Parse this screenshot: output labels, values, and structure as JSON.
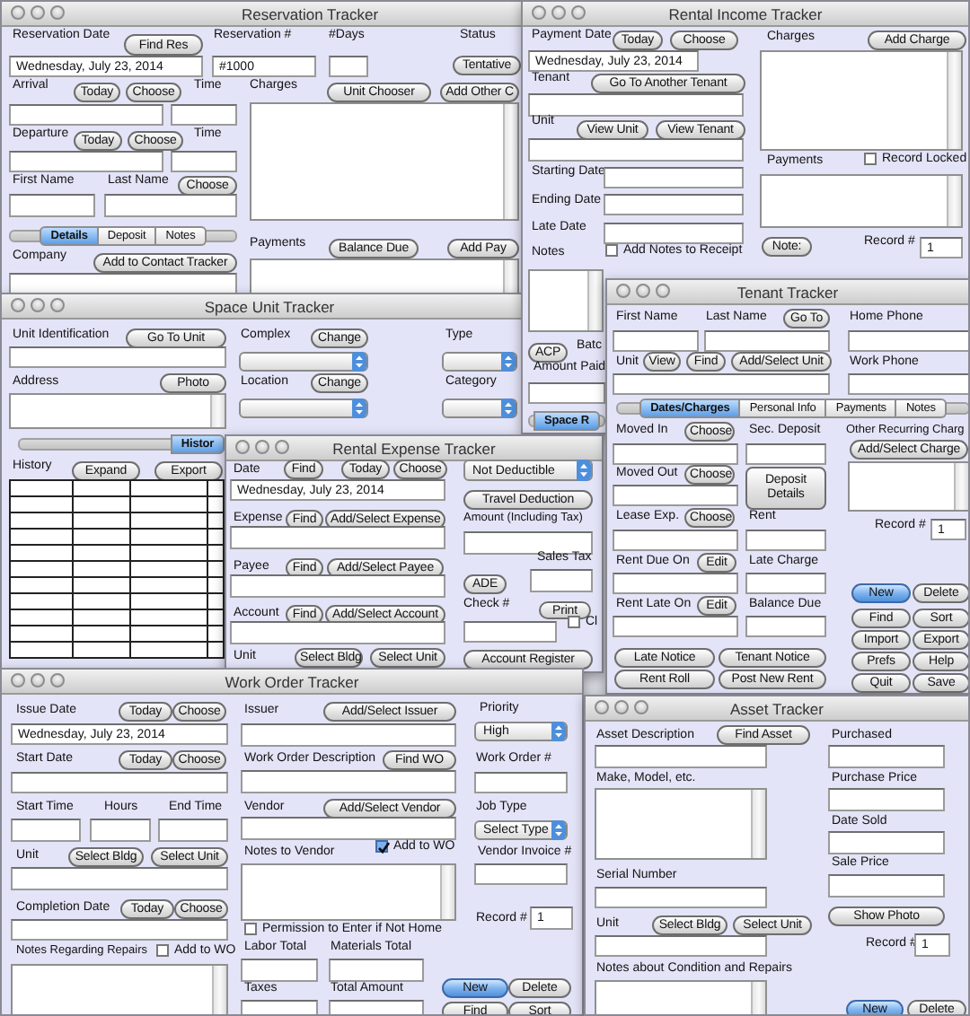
{
  "windows": [
    {
      "title": "Reservation Tracker",
      "widgets": [
        {
          "kind": "label",
          "text": "Reservation Date"
        },
        {
          "kind": "button",
          "text": "Find Res"
        },
        {
          "kind": "label",
          "text": "Reservation #"
        },
        {
          "kind": "label",
          "text": "#Days"
        },
        {
          "kind": "label",
          "text": "Status"
        },
        {
          "kind": "field",
          "value": "Wednesday, July 23, 2014"
        },
        {
          "kind": "field",
          "value": "#1000"
        },
        {
          "kind": "field"
        },
        {
          "kind": "button",
          "text": "Tentative"
        },
        {
          "kind": "label",
          "text": "Arrival"
        },
        {
          "kind": "button",
          "text": "Today"
        },
        {
          "kind": "button",
          "text": "Choose"
        },
        {
          "kind": "label",
          "text": "Time"
        },
        {
          "kind": "field"
        },
        {
          "kind": "field"
        },
        {
          "kind": "label",
          "text": "Departure"
        },
        {
          "kind": "button",
          "text": "Today"
        },
        {
          "kind": "button",
          "text": "Choose"
        },
        {
          "kind": "label",
          "text": "Time"
        },
        {
          "kind": "field"
        },
        {
          "kind": "field"
        },
        {
          "kind": "label",
          "text": "First Name"
        },
        {
          "kind": "label",
          "text": "Last Name"
        },
        {
          "kind": "button",
          "text": "Choose"
        },
        {
          "kind": "field"
        },
        {
          "kind": "field"
        },
        {
          "kind": "tabs",
          "tabs": [
            {
              "label": "Details",
              "selected": true
            },
            {
              "label": "Deposit",
              "selected": false
            },
            {
              "label": "Notes",
              "selected": false
            }
          ]
        },
        {
          "kind": "label",
          "text": "Company"
        },
        {
          "kind": "button",
          "text": "Add to Contact Tracker"
        },
        {
          "kind": "field"
        },
        {
          "kind": "label",
          "text": "Charges"
        },
        {
          "kind": "button",
          "text": "Unit Chooser"
        },
        {
          "kind": "button",
          "text": "Add Other C"
        },
        {
          "kind": "text-area"
        },
        {
          "kind": "label",
          "text": "Payments"
        },
        {
          "kind": "button",
          "text": "Balance Due"
        },
        {
          "kind": "button",
          "text": "Add Pay"
        },
        {
          "kind": "text-area"
        }
      ]
    },
    {
      "title": "Space Unit Tracker",
      "widgets": [
        {
          "kind": "label",
          "text": "Unit Identification"
        },
        {
          "kind": "button",
          "text": "Go To Unit"
        },
        {
          "kind": "field"
        },
        {
          "kind": "label",
          "text": "Address"
        },
        {
          "kind": "button",
          "text": "Photo"
        },
        {
          "kind": "text-area"
        },
        {
          "kind": "label",
          "text": "Complex"
        },
        {
          "kind": "button",
          "text": "Change"
        },
        {
          "kind": "select"
        },
        {
          "kind": "label",
          "text": "Location"
        },
        {
          "kind": "button",
          "text": "Change"
        },
        {
          "kind": "select"
        },
        {
          "kind": "label",
          "text": "Type"
        },
        {
          "kind": "select"
        },
        {
          "kind": "label",
          "text": "Category"
        },
        {
          "kind": "select"
        },
        {
          "kind": "tabs",
          "tabs": [
            {
              "label": "Histor",
              "selected": true
            }
          ]
        },
        {
          "kind": "label",
          "text": "History"
        },
        {
          "kind": "button",
          "text": "Expand"
        },
        {
          "kind": "button",
          "text": "Export"
        },
        {
          "kind": "table"
        }
      ]
    },
    {
      "title": "Rental Income Tracker",
      "widgets": [
        {
          "kind": "label",
          "text": "Payment Date"
        },
        {
          "kind": "button",
          "text": "Today"
        },
        {
          "kind": "button",
          "text": "Choose"
        },
        {
          "kind": "field",
          "value": "Wednesday, July 23, 2014"
        },
        {
          "kind": "label",
          "text": "Tenant"
        },
        {
          "kind": "button",
          "text": "Go To Another Tenant"
        },
        {
          "kind": "field"
        },
        {
          "kind": "label",
          "text": "Unit"
        },
        {
          "kind": "button",
          "text": "View Unit"
        },
        {
          "kind": "button",
          "text": "View Tenant"
        },
        {
          "kind": "field"
        },
        {
          "kind": "label",
          "text": "Starting Date"
        },
        {
          "kind": "field"
        },
        {
          "kind": "label",
          "text": "Ending Date"
        },
        {
          "kind": "field"
        },
        {
          "kind": "label",
          "text": "Late Date"
        },
        {
          "kind": "field"
        },
        {
          "kind": "label",
          "text": "Notes"
        },
        {
          "kind": "checkbox",
          "text": "Add Notes to Receipt",
          "checked": false
        },
        {
          "kind": "text-area"
        },
        {
          "kind": "button",
          "text": "ACP"
        },
        {
          "kind": "label",
          "text": "Batc"
        },
        {
          "kind": "label",
          "text": "Amount Paid"
        },
        {
          "kind": "field"
        },
        {
          "kind": "tabs",
          "tabs": [
            {
              "label": "Space R",
              "selected": true
            }
          ]
        },
        {
          "kind": "label",
          "text": "Charges"
        },
        {
          "kind": "button",
          "text": "Add Charge"
        },
        {
          "kind": "text-area"
        },
        {
          "kind": "label",
          "text": "Payments"
        },
        {
          "kind": "checkbox",
          "text": "Record Locked",
          "checked": false
        },
        {
          "kind": "text-area"
        },
        {
          "kind": "button",
          "text": "Note:"
        },
        {
          "kind": "label",
          "text": "Record #"
        },
        {
          "kind": "field",
          "value": "1"
        }
      ]
    },
    {
      "title": "Rental Expense Tracker",
      "widgets": [
        {
          "kind": "label",
          "text": "Date"
        },
        {
          "kind": "button",
          "text": "Find"
        },
        {
          "kind": "button",
          "text": "Today"
        },
        {
          "kind": "button",
          "text": "Choose"
        },
        {
          "kind": "field",
          "value": "Wednesday, July 23, 2014"
        },
        {
          "kind": "label",
          "text": "Expense"
        },
        {
          "kind": "button",
          "text": "Find"
        },
        {
          "kind": "button",
          "text": "Add/Select Expense"
        },
        {
          "kind": "field"
        },
        {
          "kind": "label",
          "text": "Payee"
        },
        {
          "kind": "button",
          "text": "Find"
        },
        {
          "kind": "button",
          "text": "Add/Select Payee"
        },
        {
          "kind": "field"
        },
        {
          "kind": "label",
          "text": "Account"
        },
        {
          "kind": "button",
          "text": "Find"
        },
        {
          "kind": "button",
          "text": "Add/Select Account"
        },
        {
          "kind": "field"
        },
        {
          "kind": "label",
          "text": "Unit"
        },
        {
          "kind": "button",
          "text": "Select Bldg"
        },
        {
          "kind": "button",
          "text": "Select Unit"
        },
        {
          "kind": "select",
          "value": "Not Deductible"
        },
        {
          "kind": "button",
          "text": "Travel Deduction"
        },
        {
          "kind": "label",
          "text": "Amount (Including Tax)"
        },
        {
          "kind": "field"
        },
        {
          "kind": "label",
          "text": "Sales Tax"
        },
        {
          "kind": "button",
          "text": "ADE"
        },
        {
          "kind": "field"
        },
        {
          "kind": "label",
          "text": "Check #"
        },
        {
          "kind": "button",
          "text": "Print"
        },
        {
          "kind": "field"
        },
        {
          "kind": "checkbox",
          "text": "Cl",
          "checked": false
        },
        {
          "kind": "button",
          "text": "Account Register"
        }
      ]
    },
    {
      "title": "Tenant Tracker",
      "widgets": [
        {
          "kind": "label",
          "text": "First Name"
        },
        {
          "kind": "label",
          "text": "Last Name"
        },
        {
          "kind": "button",
          "text": "Go To"
        },
        {
          "kind": "label",
          "text": "Home Phone"
        },
        {
          "kind": "field"
        },
        {
          "kind": "field"
        },
        {
          "kind": "field"
        },
        {
          "kind": "label",
          "text": "Unit"
        },
        {
          "kind": "button",
          "text": "View"
        },
        {
          "kind": "button",
          "text": "Find"
        },
        {
          "kind": "button",
          "text": "Add/Select Unit"
        },
        {
          "kind": "label",
          "text": "Work Phone"
        },
        {
          "kind": "field"
        },
        {
          "kind": "field"
        },
        {
          "kind": "tabs",
          "tabs": [
            {
              "label": "Dates/Charges",
              "selected": true
            },
            {
              "label": "Personal Info",
              "selected": false
            },
            {
              "label": "Payments",
              "selected": false
            },
            {
              "label": "Notes",
              "selected": false
            }
          ]
        },
        {
          "kind": "label",
          "text": "Moved In"
        },
        {
          "kind": "button",
          "text": "Choose"
        },
        {
          "kind": "label",
          "text": "Sec. Deposit"
        },
        {
          "kind": "label",
          "text": "Other Recurring Charg"
        },
        {
          "kind": "button",
          "text": "Add/Select Charge"
        },
        {
          "kind": "field"
        },
        {
          "kind": "field"
        },
        {
          "kind": "text-area"
        },
        {
          "kind": "label",
          "text": "Moved Out"
        },
        {
          "kind": "button",
          "text": "Choose"
        },
        {
          "kind": "button",
          "text": "Deposit Details"
        },
        {
          "kind": "field"
        },
        {
          "kind": "label",
          "text": "Lease Exp."
        },
        {
          "kind": "button",
          "text": "Choose"
        },
        {
          "kind": "label",
          "text": "Rent"
        },
        {
          "kind": "label",
          "text": "Record #"
        },
        {
          "kind": "field",
          "value": "1"
        },
        {
          "kind": "field"
        },
        {
          "kind": "field"
        },
        {
          "kind": "label",
          "text": "Rent Due On"
        },
        {
          "kind": "button",
          "text": "Edit"
        },
        {
          "kind": "label",
          "text": "Late Charge"
        },
        {
          "kind": "field"
        },
        {
          "kind": "field"
        },
        {
          "kind": "button",
          "text": "New",
          "primary": true
        },
        {
          "kind": "button",
          "text": "Delete"
        },
        {
          "kind": "label",
          "text": "Rent Late On"
        },
        {
          "kind": "button",
          "text": "Edit"
        },
        {
          "kind": "label",
          "text": "Balance Due"
        },
        {
          "kind": "button",
          "text": "Find"
        },
        {
          "kind": "button",
          "text": "Sort"
        },
        {
          "kind": "field"
        },
        {
          "kind": "field"
        },
        {
          "kind": "button",
          "text": "Import"
        },
        {
          "kind": "button",
          "text": "Export"
        },
        {
          "kind": "button",
          "text": "Late Notice"
        },
        {
          "kind": "button",
          "text": "Tenant Notice"
        },
        {
          "kind": "button",
          "text": "Prefs"
        },
        {
          "kind": "button",
          "text": "Help"
        },
        {
          "kind": "button",
          "text": "Rent Roll"
        },
        {
          "kind": "button",
          "text": "Post New Rent"
        },
        {
          "kind": "button",
          "text": "Quit"
        },
        {
          "kind": "button",
          "text": "Save"
        }
      ]
    },
    {
      "title": "Work Order Tracker",
      "widgets": [
        {
          "kind": "label",
          "text": "Issue Date"
        },
        {
          "kind": "button",
          "text": "Today"
        },
        {
          "kind": "button",
          "text": "Choose"
        },
        {
          "kind": "field",
          "value": "Wednesday, July 23, 2014"
        },
        {
          "kind": "label",
          "text": "Start Date"
        },
        {
          "kind": "button",
          "text": "Today"
        },
        {
          "kind": "button",
          "text": "Choose"
        },
        {
          "kind": "field"
        },
        {
          "kind": "label",
          "text": "Start Time"
        },
        {
          "kind": "label",
          "text": "Hours"
        },
        {
          "kind": "label",
          "text": "End Time"
        },
        {
          "kind": "field"
        },
        {
          "kind": "field"
        },
        {
          "kind": "field"
        },
        {
          "kind": "label",
          "text": "Unit"
        },
        {
          "kind": "button",
          "text": "Select Bldg"
        },
        {
          "kind": "button",
          "text": "Select Unit"
        },
        {
          "kind": "field"
        },
        {
          "kind": "label",
          "text": "Completion Date"
        },
        {
          "kind": "button",
          "text": "Today"
        },
        {
          "kind": "button",
          "text": "Choose"
        },
        {
          "kind": "field"
        },
        {
          "kind": "label",
          "text": "Notes Regarding Repairs"
        },
        {
          "kind": "checkbox",
          "text": "Add to WO",
          "checked": false
        },
        {
          "kind": "text-area"
        },
        {
          "kind": "label",
          "text": "Issuer"
        },
        {
          "kind": "button",
          "text": "Add/Select Issuer"
        },
        {
          "kind": "field"
        },
        {
          "kind": "label",
          "text": "Work Order Description"
        },
        {
          "kind": "button",
          "text": "Find WO"
        },
        {
          "kind": "field"
        },
        {
          "kind": "label",
          "text": "Vendor"
        },
        {
          "kind": "button",
          "text": "Add/Select Vendor"
        },
        {
          "kind": "field"
        },
        {
          "kind": "label",
          "text": "Notes to Vendor"
        },
        {
          "kind": "checkbox",
          "text": "Add to WO",
          "checked": true
        },
        {
          "kind": "text-area"
        },
        {
          "kind": "checkbox",
          "text": "Permission to Enter if Not Home",
          "checked": false
        },
        {
          "kind": "label",
          "text": "Labor Total"
        },
        {
          "kind": "label",
          "text": "Materials Total"
        },
        {
          "kind": "field"
        },
        {
          "kind": "field"
        },
        {
          "kind": "label",
          "text": "Taxes"
        },
        {
          "kind": "label",
          "text": "Total Amount"
        },
        {
          "kind": "field"
        },
        {
          "kind": "field"
        },
        {
          "kind": "label",
          "text": "Priority"
        },
        {
          "kind": "select",
          "value": "High"
        },
        {
          "kind": "label",
          "text": "Work Order #"
        },
        {
          "kind": "field"
        },
        {
          "kind": "label",
          "text": "Job Type"
        },
        {
          "kind": "select",
          "value": "Select Type"
        },
        {
          "kind": "label",
          "text": "Vendor Invoice #"
        },
        {
          "kind": "field"
        },
        {
          "kind": "label",
          "text": "Record #"
        },
        {
          "kind": "field",
          "value": "1"
        },
        {
          "kind": "button",
          "text": "New",
          "primary": true
        },
        {
          "kind": "button",
          "text": "Delete"
        },
        {
          "kind": "button",
          "text": "Find"
        },
        {
          "kind": "button",
          "text": "Sort"
        }
      ]
    },
    {
      "title": "Asset Tracker",
      "widgets": [
        {
          "kind": "label",
          "text": "Asset Description"
        },
        {
          "kind": "button",
          "text": "Find Asset"
        },
        {
          "kind": "field"
        },
        {
          "kind": "label",
          "text": "Make, Model, etc."
        },
        {
          "kind": "text-area"
        },
        {
          "kind": "label",
          "text": "Serial Number"
        },
        {
          "kind": "field"
        },
        {
          "kind": "label",
          "text": "Unit"
        },
        {
          "kind": "button",
          "text": "Select Bldg"
        },
        {
          "kind": "button",
          "text": "Select Unit"
        },
        {
          "kind": "field"
        },
        {
          "kind": "label",
          "text": "Notes about Condition and Repairs"
        },
        {
          "kind": "text-area"
        },
        {
          "kind": "label",
          "text": "Purchased"
        },
        {
          "kind": "field"
        },
        {
          "kind": "label",
          "text": "Purchase Price"
        },
        {
          "kind": "field"
        },
        {
          "kind": "label",
          "text": "Date Sold"
        },
        {
          "kind": "field"
        },
        {
          "kind": "label",
          "text": "Sale Price"
        },
        {
          "kind": "field"
        },
        {
          "kind": "button",
          "text": "Show Photo"
        },
        {
          "kind": "label",
          "text": "Record #"
        },
        {
          "kind": "field",
          "value": "1"
        },
        {
          "kind": "button",
          "text": "New",
          "primary": true
        },
        {
          "kind": "button",
          "text": "Delete"
        }
      ]
    }
  ]
}
